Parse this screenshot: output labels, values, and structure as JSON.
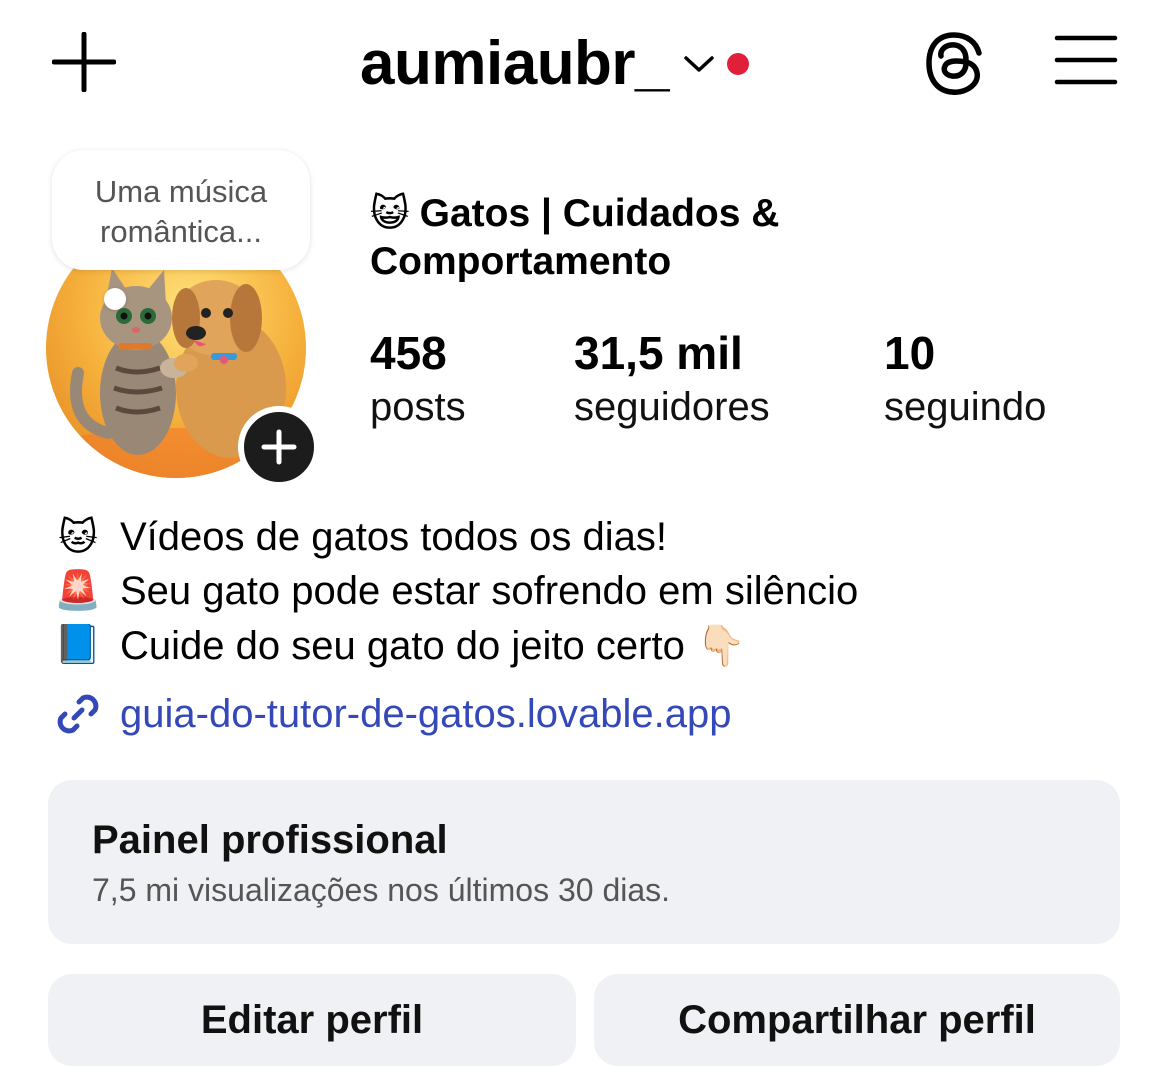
{
  "header": {
    "username": "aumiaubr_",
    "icons": {
      "create": "plus-icon",
      "switch": "chevron-down-icon",
      "notification": "red-dot-icon",
      "threads": "threads-icon",
      "menu": "hamburger-menu-icon"
    },
    "notification_color": "#e0203a"
  },
  "profile": {
    "avatar_icon": "profile-photo-cat-and-dog",
    "note": {
      "line1": "Uma música",
      "line2": "romântica..."
    },
    "name_emoji": "😺",
    "display_name": "Gatos | Cuidados & Comportamento",
    "stats": [
      {
        "value": "458",
        "label": "posts"
      },
      {
        "value": "31,5 mil",
        "label": "seguidores"
      },
      {
        "value": "10",
        "label": "seguindo"
      }
    ]
  },
  "bio": {
    "lines": [
      {
        "emoji": "🐱",
        "text": "Vídeos de gatos todos os dias!"
      },
      {
        "emoji": "🚨",
        "text": "Seu gato pode estar sofrendo em silêncio"
      },
      {
        "emoji": "📘",
        "text": "Cuide do seu gato do jeito certo 👇🏻"
      }
    ],
    "link": "guia-do-tutor-de-gatos.lovable.app",
    "link_color": "#3448b8"
  },
  "professional_dashboard": {
    "title": "Painel profissional",
    "subtitle": "7,5 mi visualizações nos últimos 30 dias."
  },
  "actions": {
    "edit_label": "Editar perfil",
    "share_label": "Compartilhar perfil"
  }
}
